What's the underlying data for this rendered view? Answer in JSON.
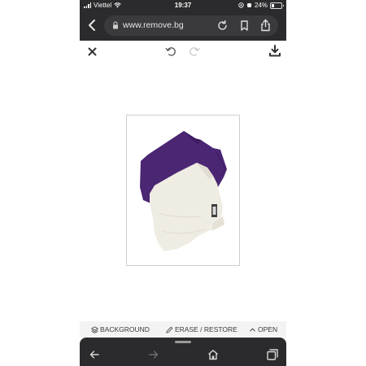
{
  "status_bar": {
    "carrier": "Viettel",
    "time": "19:37",
    "battery": "24%"
  },
  "browser": {
    "url": "www.remove.bg"
  },
  "editor": {
    "tools": {
      "background": "BACKGROUND",
      "erase_restore": "ERASE / RESTORE",
      "open": "OPEN"
    }
  },
  "icons": {
    "toolbar": [
      "back-icon",
      "lock-icon",
      "reload-icon",
      "bookmark-icon",
      "share-icon"
    ],
    "app_bar": [
      "close-icon",
      "undo-icon",
      "redo-icon",
      "download-icon"
    ],
    "bottom_nav": [
      "back-icon",
      "forward-icon",
      "home-icon",
      "tabs-icon"
    ]
  },
  "colors": {
    "chrome_dark": "#2b2b2d",
    "purple_shirt": "#4a2673",
    "white_shirt": "#efece3"
  }
}
